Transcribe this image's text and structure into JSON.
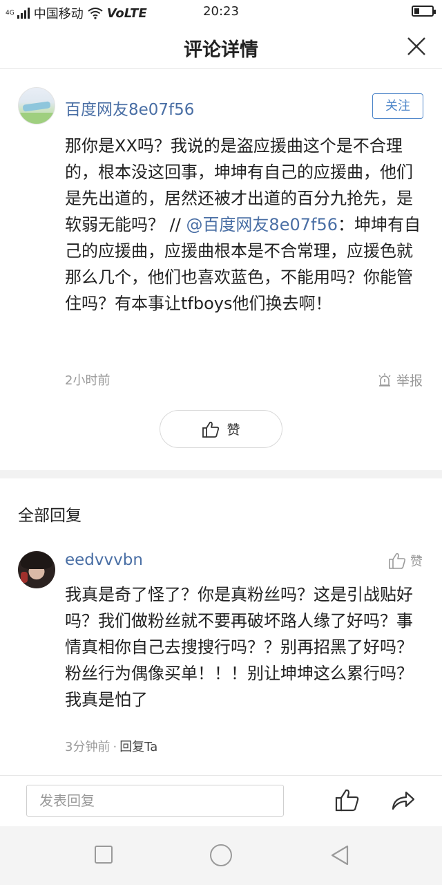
{
  "status_bar": {
    "signal_label": "4G",
    "carrier": "中国移动",
    "volte": "VoLTE",
    "time": "20:23",
    "battery_level": 0.3
  },
  "header": {
    "title": "评论详情",
    "close_icon": "close-icon"
  },
  "main_comment": {
    "username": "百度网友8e07f56",
    "follow_label": "关注",
    "text_before": "那你是XX吗？我说的是盗应援曲这个是不合理的，根本没这回事，坤坤有自己的应援曲，他们是先出道的，居然还被才出道的百分九抢先，是软弱无能吗？ // ",
    "mention": "@百度网友8e07f56",
    "text_after": "：坤坤有自己的应援曲，应援曲根本是不合常理，应援色就那么几个，他们也喜欢蓝色，不能用吗？你能管住吗？有本事让tfboys他们换去啊！",
    "time": "2小时前",
    "report_label": "举报",
    "like_label": "赞"
  },
  "replies_section": {
    "title": "全部回复"
  },
  "reply": {
    "username": "eedvvvbn",
    "like_label": "赞",
    "text": "我真是奇了怪了？你是真粉丝吗？这是引战贴好吗？我们做粉丝就不要再破坏路人缘了好吗？事情真相你自己去搜搜行吗？？别再招黑了好吗？粉丝行为偶像买单！！！别让坤坤这么累行吗？我真是怕了",
    "time": "3分钟前",
    "separator": "·",
    "reply_label": "回复Ta"
  },
  "input_bar": {
    "placeholder": "发表回复"
  },
  "colors": {
    "link": "#4a6fa5",
    "follow": "#4e86c9",
    "muted": "#999999"
  }
}
